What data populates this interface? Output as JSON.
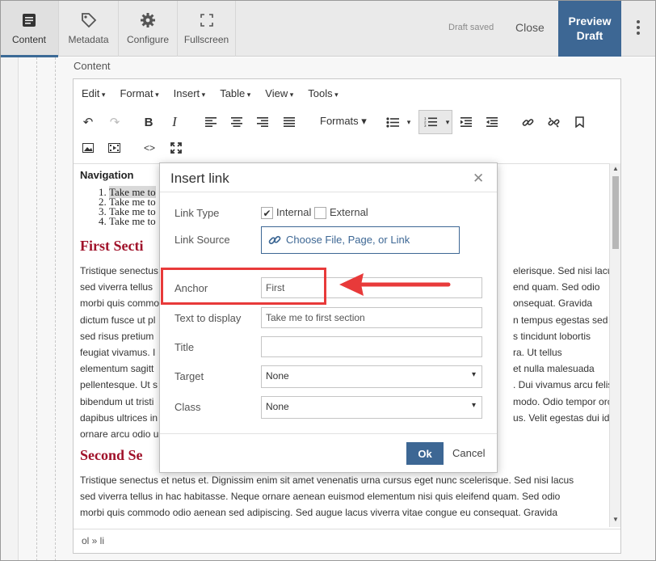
{
  "topbar": {
    "tabs": [
      {
        "label": "Content",
        "icon": "document-icon",
        "active": true
      },
      {
        "label": "Metadata",
        "icon": "tag-icon"
      },
      {
        "label": "Configure",
        "icon": "gear-icon"
      },
      {
        "label": "Fullscreen",
        "icon": "fullscreen-icon"
      }
    ],
    "draft_status": "Draft saved",
    "close_label": "Close",
    "preview_label_1": "Preview",
    "preview_label_2": "Draft",
    "accent_color": "#3d6794"
  },
  "content_label": "Content",
  "editor": {
    "menu": [
      "Edit",
      "Format",
      "Insert",
      "Table",
      "View",
      "Tools"
    ],
    "formats_label": "Formats",
    "doc": {
      "nav_heading": "Navigation",
      "nav_items": [
        "Take me to",
        "Take me to",
        "Take me to",
        "Take me to"
      ],
      "section1_heading": "First Secti",
      "section1_lines": [
        "Tristique senectus",
        "sed viverra tellus",
        "morbi quis commo",
        "dictum fusce ut pl",
        "sed risus pretium",
        "feugiat vivamus. I",
        "elementum sagitt",
        "pellentesque. Ut s",
        "bibendum ut tristi",
        "dapibus ultrices in",
        "ornare arcu odio u"
      ],
      "section1_right": [
        "elerisque. Sed nisi lacus",
        "end quam. Sed odio",
        "onsequat. Gravida",
        "n tempus egestas sed",
        "s tincidunt lobortis",
        "ra. Ut tellus",
        "et nulla malesuada",
        ". Dui vivamus arcu felis",
        "modo. Odio tempor orci",
        "us. Velit egestas dui id",
        ""
      ],
      "section2_heading": "Second Se",
      "section2_text": [
        "Tristique senectus et netus et. Dignissim enim sit amet venenatis urna cursus eget nunc scelerisque. Sed nisi lacus",
        "sed viverra tellus in hac habitasse. Neque ornare aenean euismod elementum nisi quis eleifend quam. Sed odio",
        "morbi quis commodo odio aenean sed adipiscing. Sed augue lacus viverra vitae congue eu consequat. Gravida"
      ]
    },
    "status_path": "ol » li"
  },
  "dialog": {
    "title": "Insert link",
    "link_type_label": "Link Type",
    "internal_label": "Internal",
    "internal_checked": true,
    "external_label": "External",
    "external_checked": false,
    "link_source_label": "Link Source",
    "link_source_button": "Choose File, Page, or Link",
    "anchor_label": "Anchor",
    "anchor_value": "First",
    "text_label": "Text to display",
    "text_value": "Take me to first section",
    "title_label": "Title",
    "title_value": "",
    "target_label": "Target",
    "target_value": "None",
    "class_label": "Class",
    "class_value": "None",
    "ok_label": "Ok",
    "cancel_label": "Cancel"
  },
  "annotation_color": "#e83a3a"
}
